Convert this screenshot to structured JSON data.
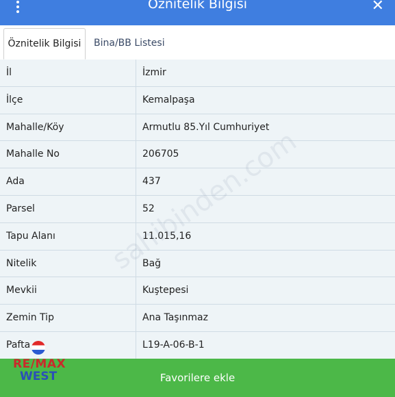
{
  "header": {
    "title": "Öznitelik Bilgisi",
    "menu_icon": "more-vertical-icon",
    "close_icon": "close-icon"
  },
  "tabs": [
    {
      "label": "Öznitelik Bilgisi",
      "active": true
    },
    {
      "label": "Bina/BB Listesi",
      "active": false
    }
  ],
  "rows": [
    {
      "label": "İl",
      "value": "İzmir"
    },
    {
      "label": "İlçe",
      "value": "Kemalpaşa"
    },
    {
      "label": "Mahalle/Köy",
      "value": "Armutlu 85.Yıl Cumhuriyet"
    },
    {
      "label": "Mahalle No",
      "value": "206705"
    },
    {
      "label": "Ada",
      "value": "437"
    },
    {
      "label": "Parsel",
      "value": "52"
    },
    {
      "label": "Tapu Alanı",
      "value": "11.015,16"
    },
    {
      "label": "Nitelik",
      "value": "Bağ"
    },
    {
      "label": "Mevkii",
      "value": "Kuştepesi"
    },
    {
      "label": "Zemin Tip",
      "value": "Ana Taşınmaz"
    },
    {
      "label": "Pafta",
      "value": "L19-A-06-B-1"
    }
  ],
  "footer": {
    "button_label": "Favorilere ekle"
  },
  "logo": {
    "line1": "RE/MAX",
    "line2": "WEST"
  },
  "watermark": "sahibinden.com",
  "colors": {
    "header": "#3f7ee0",
    "footer": "#4cb848",
    "row_bg": "#eef4f7"
  }
}
